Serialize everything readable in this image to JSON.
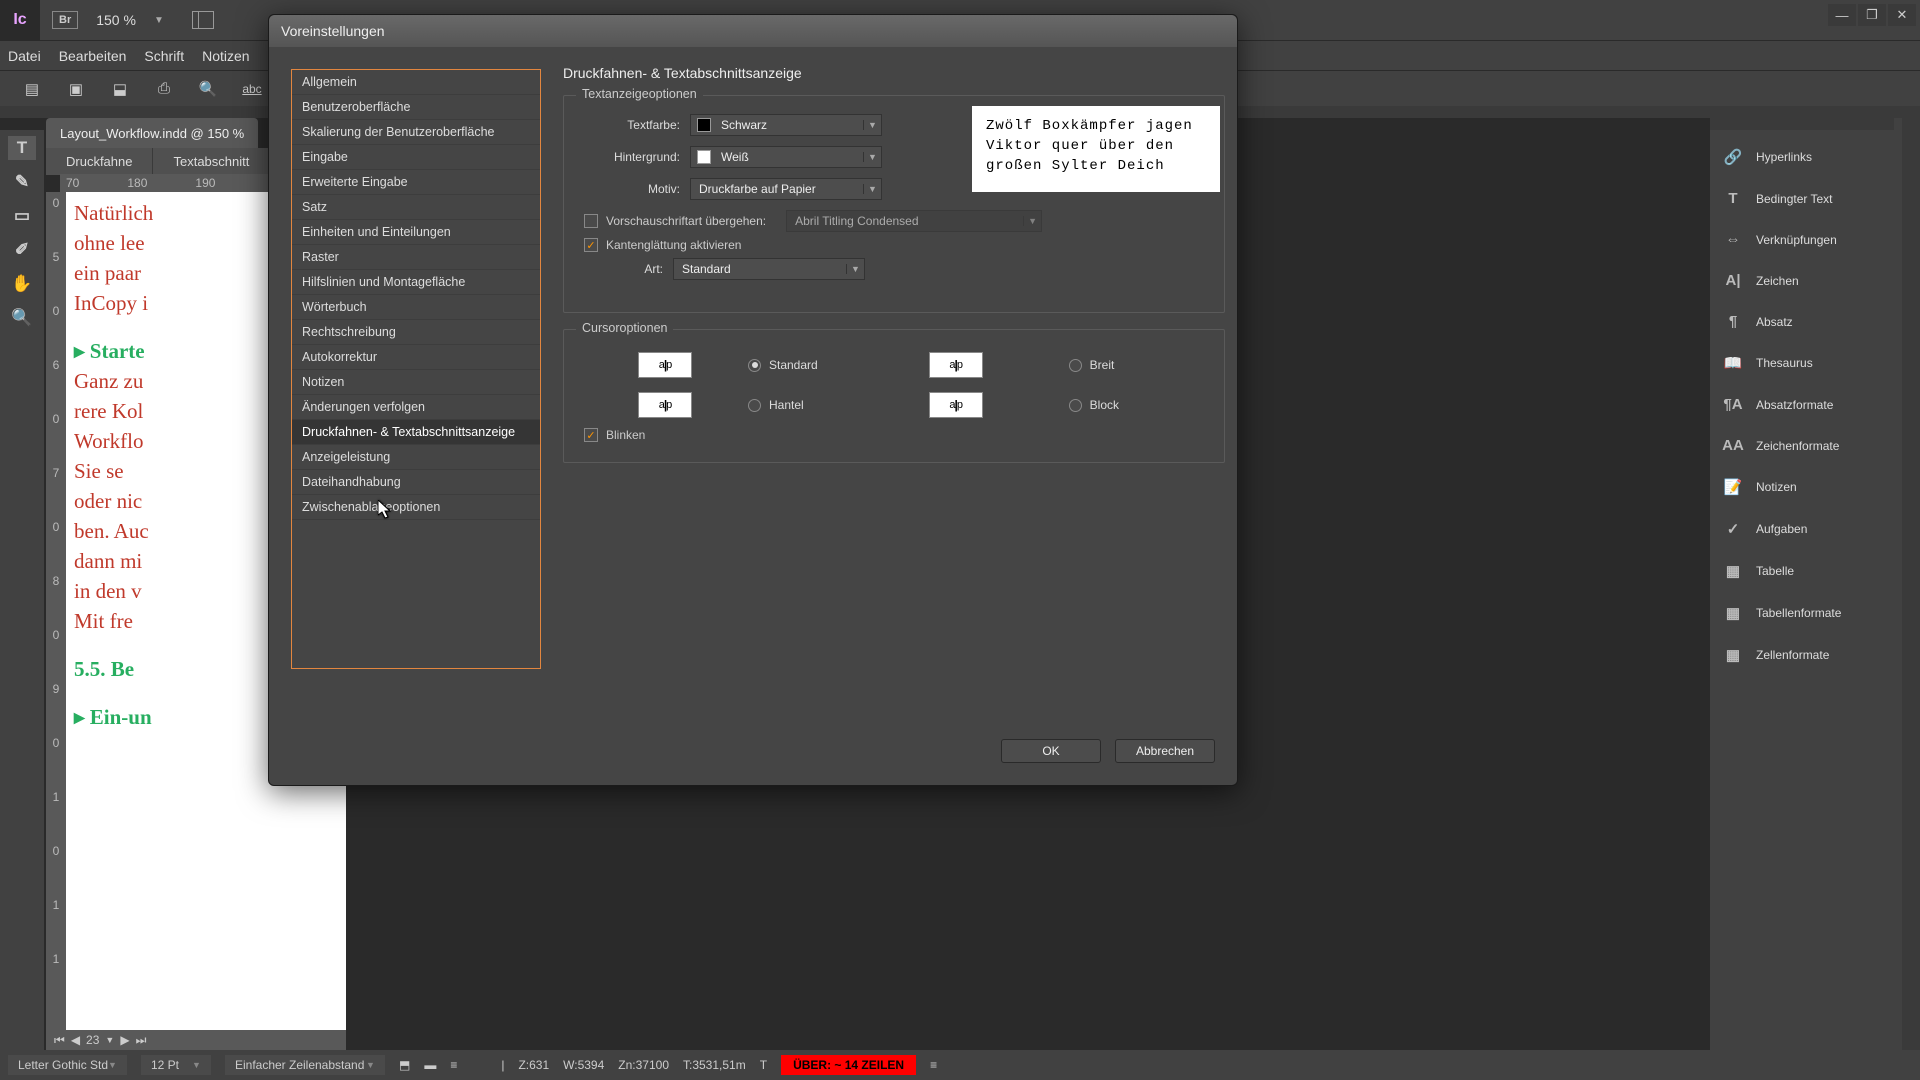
{
  "app": {
    "logo": "Ic",
    "br": "Br",
    "zoom": "150 %"
  },
  "winControls": {
    "min": "—",
    "max": "❐",
    "close": "✕"
  },
  "menu": [
    "Datei",
    "Bearbeiten",
    "Schrift",
    "Notizen"
  ],
  "docTab": "Layout_Workflow.indd @ 150 %",
  "modeTabs": [
    "Druckfahne",
    "Textabschnitt"
  ],
  "rulerH": [
    "70",
    "180",
    "190"
  ],
  "rulerV": [
    "0",
    "5",
    "0",
    "6",
    "0",
    "7",
    "0",
    "8",
    "0",
    "9",
    "0",
    "1",
    "0",
    "1",
    "1"
  ],
  "docLines": [
    {
      "cls": "line",
      "txt": "Natürlich"
    },
    {
      "cls": "line",
      "txt": "ohne lee"
    },
    {
      "cls": "line",
      "txt": "ein paar"
    },
    {
      "cls": "line",
      "txt": "InCopy i"
    },
    {
      "cls": "spacer",
      "txt": ""
    },
    {
      "cls": "line green",
      "txt": "▸  Starte"
    },
    {
      "cls": "line",
      "txt": "Ganz zu"
    },
    {
      "cls": "line",
      "txt": "rere Kol"
    },
    {
      "cls": "line",
      "txt": "Workflo"
    },
    {
      "cls": "line",
      "txt": "   Sie se"
    },
    {
      "cls": "line",
      "txt": "oder nic"
    },
    {
      "cls": "line",
      "txt": "ben. Auc"
    },
    {
      "cls": "line",
      "txt": "dann mi"
    },
    {
      "cls": "line",
      "txt": "in den v"
    },
    {
      "cls": "line",
      "txt": "   Mit fre"
    },
    {
      "cls": "spacer",
      "txt": ""
    },
    {
      "cls": "line green",
      "txt": "5.5.  Be"
    },
    {
      "cls": "spacer",
      "txt": ""
    },
    {
      "cls": "line green",
      "txt": "▸  Ein-un"
    }
  ],
  "rightPanels": [
    {
      "ico": "🔗",
      "lbl": "Hyperlinks"
    },
    {
      "ico": "T",
      "lbl": "Bedingter Text"
    },
    {
      "ico": "⇔",
      "lbl": "Verknüpfungen"
    },
    {
      "ico": "A|",
      "lbl": "Zeichen"
    },
    {
      "ico": "¶",
      "lbl": "Absatz"
    },
    {
      "ico": "📖",
      "lbl": "Thesaurus"
    },
    {
      "ico": "¶A",
      "lbl": "Absatzformate"
    },
    {
      "ico": "AA",
      "lbl": "Zeichenformate"
    },
    {
      "ico": "📝",
      "lbl": "Notizen"
    },
    {
      "ico": "✓",
      "lbl": "Aufgaben"
    },
    {
      "ico": "▦",
      "lbl": "Tabelle"
    },
    {
      "ico": "▦",
      "lbl": "Tabellenformate"
    },
    {
      "ico": "▦",
      "lbl": "Zellenformate"
    }
  ],
  "status": {
    "font": "Letter Gothic Std",
    "size": "12 Pt",
    "leading": "Einfacher Zeilenabstand",
    "z": "Z:631",
    "w": "W:5394",
    "zn": "Zn:37100",
    "t": "T:3531,51m",
    "overset": "ÜBER:  ~ 14 ZEILEN"
  },
  "pager": {
    "page": "23"
  },
  "dialog": {
    "title": "Voreinstellungen",
    "categories": [
      "Allgemein",
      "Benutzeroberfläche",
      "Skalierung der Benutzeroberfläche",
      "Eingabe",
      "Erweiterte Eingabe",
      "Satz",
      "Einheiten und Einteilungen",
      "Raster",
      "Hilfslinien und Montagefläche",
      "Wörterbuch",
      "Rechtschreibung",
      "Autokorrektur",
      "Notizen",
      "Änderungen verfolgen",
      "Druckfahnen- & Textabschnittsanzeige",
      "Anzeigeleistung",
      "Dateihandhabung",
      "Zwischenablageoptionen"
    ],
    "selectedCategory": "Druckfahnen- & Textabschnittsanzeige",
    "panelTitle": "Druckfahnen- & Textabschnittsanzeige",
    "group1": {
      "legend": "Textanzeigeoptionen",
      "textColorLbl": "Textfarbe:",
      "textColor": "Schwarz",
      "bgLbl": "Hintergrund:",
      "bg": "Weiß",
      "motivLbl": "Motiv:",
      "motiv": "Druckfarbe auf Papier",
      "overrideLbl": "Vorschauschriftart übergehen:",
      "overrideFont": "Abril Titling Condensed",
      "aaLbl": "Kantenglättung aktivieren",
      "artLbl": "Art:",
      "art": "Standard",
      "preview": "Zwölf Boxkämpfer jagen\nViktor quer über den\ngroßen Sylter Deich"
    },
    "group2": {
      "legend": "Cursoroptionen",
      "opts": [
        {
          "name": "Standard",
          "on": true
        },
        {
          "name": "Breit",
          "on": false
        },
        {
          "name": "Hantel",
          "on": false
        },
        {
          "name": "Block",
          "on": false
        }
      ],
      "blink": "Blinken"
    },
    "btnOk": "OK",
    "btnCancel": "Abbrechen"
  }
}
